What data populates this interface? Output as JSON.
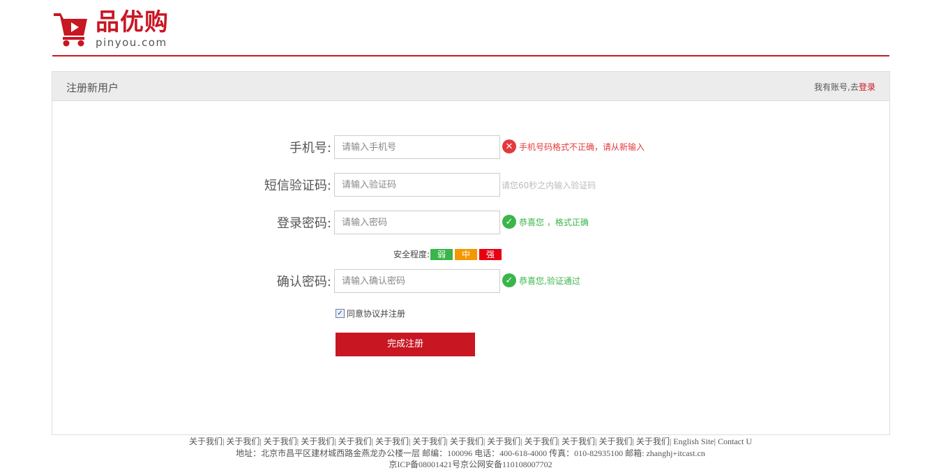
{
  "brand": {
    "name_cn": "品优购",
    "domain": "pinyou.com",
    "accent_color": "#c81623"
  },
  "panel": {
    "title": "注册新用户",
    "login_prefix": "我有账号,去",
    "login_link": "登录"
  },
  "form": {
    "phone": {
      "label": "手机号:",
      "placeholder": "请输入手机号",
      "message": "手机号码格式不正确，请从新输入",
      "status": "error",
      "icon": "error-icon"
    },
    "sms": {
      "label": "短信验证码:",
      "placeholder": "请输入验证码",
      "message": "请您60秒之内输入验证码",
      "status": "hint"
    },
    "password": {
      "label": "登录密码:",
      "placeholder": "请输入密码",
      "message": "恭喜您 ，格式正确",
      "status": "ok",
      "icon": "check-icon"
    },
    "strength": {
      "label": "安全程度:",
      "levels": [
        "弱",
        "中",
        "强"
      ],
      "colors": [
        "#3ab54a",
        "#f39800",
        "#e60012"
      ]
    },
    "confirm": {
      "label": "确认密码:",
      "placeholder": "请输入确认密码",
      "message": "恭喜您,验证通过",
      "status": "ok",
      "icon": "check-icon"
    },
    "agree": {
      "label": "同意协议并注册",
      "checked": true
    },
    "submit_label": "完成注册"
  },
  "footer": {
    "links": [
      "关于我们|",
      "关于我们|",
      "关于我们|",
      "关于我们|",
      "关于我们|",
      "关于我们|",
      "关于我们|",
      "关于我们|",
      "关于我们|",
      "关于我们|",
      "关于我们|",
      "关于我们|",
      "关于我们|",
      "English Site|",
      "Contact U"
    ],
    "address": "地址：北京市昌平区建材城西路金燕龙办公楼一层 邮编：100096 电话：400-618-4000 传真：010-82935100 邮箱: zhanghj+itcast.cn",
    "icp": "京ICP备08001421号京公网安备110108007702"
  }
}
